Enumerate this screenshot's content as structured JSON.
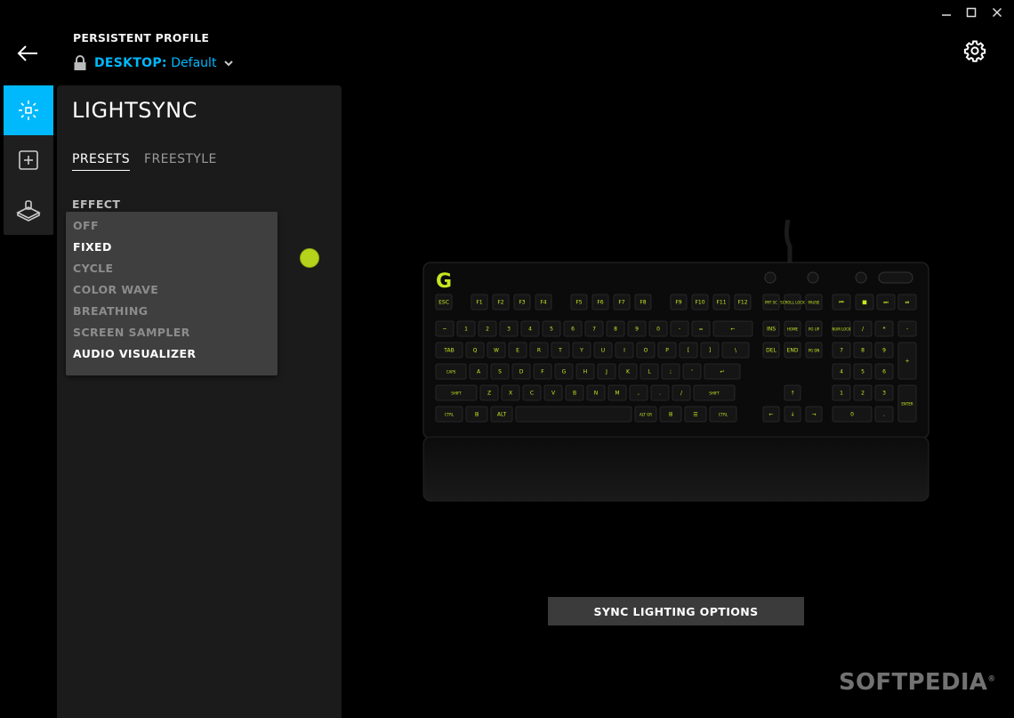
{
  "window": {
    "minimize_icon": "minimize-icon",
    "maximize_icon": "maximize-icon",
    "close_icon": "close-icon"
  },
  "header": {
    "profile_label": "PERSISTENT PROFILE",
    "profile_prefix": "DESKTOP:",
    "profile_name": "Default"
  },
  "rail": {
    "items": [
      {
        "icon": "lightsync-icon",
        "active": true
      },
      {
        "icon": "assignments-icon",
        "active": false
      },
      {
        "icon": "game-mode-icon",
        "active": false
      }
    ]
  },
  "panel": {
    "title": "LIGHTSYNC",
    "tabs": [
      {
        "label": "PRESETS",
        "active": true
      },
      {
        "label": "FREESTYLE",
        "active": false
      }
    ],
    "effect_label": "EFFECT",
    "effect_options": [
      "OFF",
      "FIXED",
      "CYCLE",
      "COLOR WAVE",
      "BREATHING",
      "SCREEN SAMPLER",
      "AUDIO VISUALIZER"
    ],
    "color_swatch": "#b5d31a"
  },
  "main": {
    "sync_button": "SYNC LIGHTING OPTIONS"
  },
  "keyboard": {
    "accent": "#c8e621",
    "fn_row": [
      "ESC",
      "F1",
      "F2",
      "F3",
      "F4",
      "F5",
      "F6",
      "F7",
      "F8",
      "F9",
      "F10",
      "F11",
      "F12"
    ],
    "number_row": [
      "~",
      "1",
      "2",
      "3",
      "4",
      "5",
      "6",
      "7",
      "8",
      "9",
      "0",
      "-",
      "=",
      "←"
    ],
    "q_row": [
      "TAB",
      "Q",
      "W",
      "E",
      "R",
      "T",
      "Y",
      "U",
      "I",
      "O",
      "P",
      "[",
      "]",
      "\\"
    ],
    "a_row": [
      "CAPS",
      "A",
      "S",
      "D",
      "F",
      "G",
      "H",
      "J",
      "K",
      "L",
      ";",
      "'",
      "↵"
    ],
    "z_row": [
      "SHIFT",
      "Z",
      "X",
      "C",
      "V",
      "B",
      "N",
      "M",
      ",",
      ".",
      "/",
      "SHIFT"
    ],
    "bottom_row": [
      "CTRL",
      "⊞",
      "ALT",
      "",
      "ALT GR",
      "⊞",
      "☰",
      "CTRL"
    ],
    "nav_top": [
      "PRT SC",
      "SCROLL LOCK",
      "PAUSE"
    ],
    "nav_mid1": [
      "INS",
      "HOME",
      "PG UP"
    ],
    "nav_mid2": [
      "DEL",
      "END",
      "PG DN"
    ],
    "arrows": [
      "↑",
      "←",
      "↓",
      "→"
    ],
    "numpad": [
      [
        "NUM LOCK",
        "/",
        "*",
        "-"
      ],
      [
        "7",
        "8",
        "9",
        "+"
      ],
      [
        "4",
        "5",
        "6"
      ],
      [
        "1",
        "2",
        "3",
        "ENTER"
      ],
      [
        "0",
        "."
      ]
    ],
    "media": [
      "⏮",
      "■",
      "⏭",
      "⏯"
    ]
  },
  "watermark": "SOFTPEDIA"
}
